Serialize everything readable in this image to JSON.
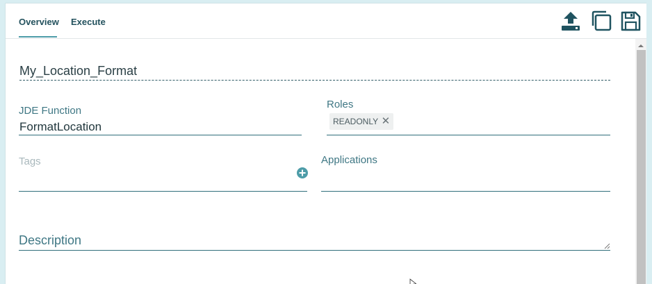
{
  "tabs": [
    {
      "label": "Overview",
      "active": true
    },
    {
      "label": "Execute",
      "active": false
    }
  ],
  "toolbar": {
    "icons": [
      "upload-icon",
      "copy-icon",
      "save-icon"
    ],
    "accent": "#1f5360"
  },
  "form": {
    "name": "My_Location_Format",
    "jde_function": {
      "label": "JDE Function",
      "value": "FormatLocation"
    },
    "roles": {
      "label": "Roles",
      "chips": [
        "READONLY"
      ]
    },
    "tags": {
      "label": "Tags"
    },
    "applications": {
      "label": "Applications"
    },
    "description": {
      "placeholder": "Description"
    }
  },
  "colors": {
    "tab_underline": "#4d9ca8",
    "label": "#3f7784",
    "background": "#d9eef2"
  }
}
